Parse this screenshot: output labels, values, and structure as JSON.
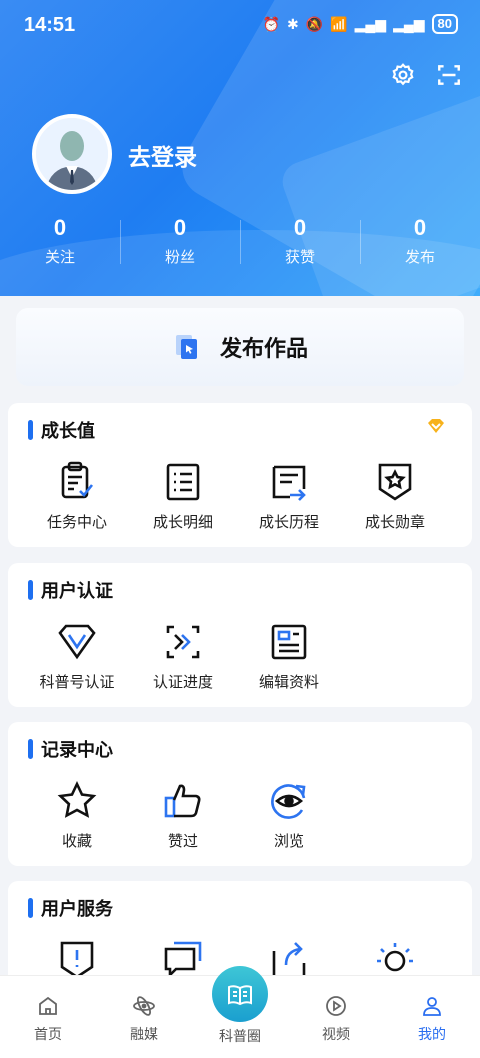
{
  "status_bar": {
    "time": "14:51",
    "battery": "80"
  },
  "profile": {
    "login_text": "去登录"
  },
  "stats": [
    {
      "value": "0",
      "label": "关注"
    },
    {
      "value": "0",
      "label": "粉丝"
    },
    {
      "value": "0",
      "label": "获赞"
    },
    {
      "value": "0",
      "label": "发布"
    }
  ],
  "publish": {
    "label": "发布作品"
  },
  "growth": {
    "title": "成长值",
    "items": [
      "任务中心",
      "成长明细",
      "成长历程",
      "成长勋章"
    ]
  },
  "auth": {
    "title": "用户认证",
    "items": [
      "科普号认证",
      "认证进度",
      "编辑资料"
    ]
  },
  "records": {
    "title": "记录中心",
    "items": [
      "收藏",
      "赞过",
      "浏览"
    ]
  },
  "services": {
    "title": "用户服务"
  },
  "nav": {
    "home": "首页",
    "media": "融媒",
    "center": "科普圈",
    "video": "视频",
    "mine": "我的"
  },
  "colors": {
    "accent": "#1e6ff0",
    "header": "#2a86f4",
    "active_nav": "#2a6ef0"
  }
}
